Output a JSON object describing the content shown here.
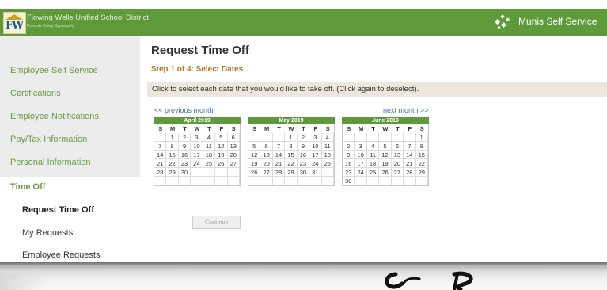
{
  "header": {
    "logo_letters": "FW",
    "district_name": "Flowing Wells Unified School District",
    "district_motto": "Promote Every Opportunity",
    "app_title": "Munis Self Service",
    "bg_color": "#5f9a3a"
  },
  "sidebar": {
    "items": [
      {
        "label": "Employee Self Service"
      },
      {
        "label": "Certifications"
      },
      {
        "label": "Employee Notifications"
      },
      {
        "label": "Pay/Tax Information"
      },
      {
        "label": "Personal Information"
      },
      {
        "label": "Time Off"
      }
    ],
    "subitems": [
      {
        "label": "Request Time Off"
      },
      {
        "label": "My Requests"
      },
      {
        "label": "Employee Requests"
      }
    ]
  },
  "main": {
    "title": "Request Time Off",
    "step": "Step 1 of 4: Select Dates",
    "instructions": "Click to select each date that you would like to take off. (Click again to deselect).",
    "prev_month": "<< previous month",
    "next_month": "next month >>",
    "continue_label": "Continue"
  },
  "calendars": [
    {
      "title": "April 2019",
      "dow": [
        "S",
        "M",
        "T",
        "W",
        "T",
        "F",
        "S"
      ],
      "weeks": [
        [
          "",
          "1",
          "2",
          "3",
          "4",
          "5",
          "6"
        ],
        [
          "7",
          "8",
          "9",
          "10",
          "11",
          "12",
          "13"
        ],
        [
          "14",
          "15",
          "16",
          "17",
          "18",
          "19",
          "20"
        ],
        [
          "21",
          "22",
          "23",
          "24",
          "25",
          "26",
          "27"
        ],
        [
          "28",
          "29",
          "30",
          "",
          "",
          "",
          ""
        ],
        [
          "",
          "",
          "",
          "",
          "",
          "",
          ""
        ]
      ]
    },
    {
      "title": "May 2019",
      "dow": [
        "S",
        "M",
        "T",
        "W",
        "T",
        "F",
        "S"
      ],
      "weeks": [
        [
          "",
          "",
          "",
          "1",
          "2",
          "3",
          "4"
        ],
        [
          "5",
          "6",
          "7",
          "8",
          "9",
          "10",
          "11"
        ],
        [
          "12",
          "13",
          "14",
          "15",
          "16",
          "17",
          "18"
        ],
        [
          "19",
          "20",
          "21",
          "22",
          "23",
          "24",
          "25"
        ],
        [
          "26",
          "27",
          "28",
          "29",
          "30",
          "31",
          ""
        ],
        [
          "",
          "",
          "",
          "",
          "",
          "",
          ""
        ]
      ]
    },
    {
      "title": "June 2019",
      "dow": [
        "S",
        "M",
        "T",
        "W",
        "T",
        "F",
        "S"
      ],
      "weeks": [
        [
          "",
          "",
          "",
          "",
          "",
          "",
          "1"
        ],
        [
          "2",
          "3",
          "4",
          "5",
          "6",
          "7",
          "8"
        ],
        [
          "9",
          "10",
          "11",
          "12",
          "13",
          "14",
          "15"
        ],
        [
          "16",
          "17",
          "18",
          "19",
          "20",
          "21",
          "22"
        ],
        [
          "23",
          "24",
          "25",
          "26",
          "27",
          "28",
          "29"
        ],
        [
          "30",
          "",
          "",
          "",
          "",
          "",
          ""
        ]
      ]
    }
  ]
}
